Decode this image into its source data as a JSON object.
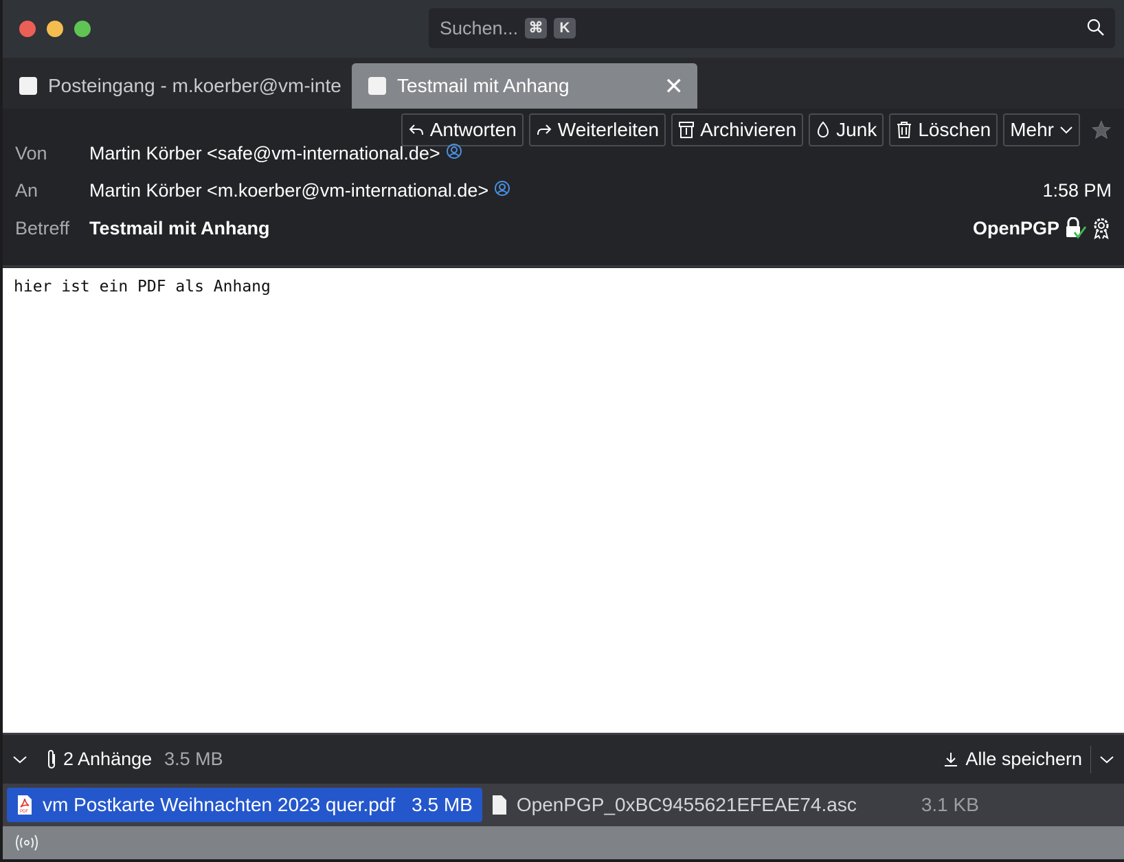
{
  "window": {
    "traffic_lights": {
      "close": "#ec5f57",
      "minimize": "#f5bd4f",
      "zoom": "#5fc454"
    }
  },
  "search": {
    "placeholder": "Suchen...",
    "shortcut_keys": [
      "⌘",
      "K"
    ]
  },
  "tabs": [
    {
      "label": "Posteingang - m.koerber@vm-inte",
      "active": false
    },
    {
      "label": "Testmail mit Anhang",
      "active": true,
      "close": "✕"
    }
  ],
  "toolbar": {
    "reply": "Antworten",
    "forward": "Weiterleiten",
    "archive": "Archivieren",
    "junk": "Junk",
    "delete": "Löschen",
    "more": "Mehr"
  },
  "message": {
    "from_label": "Von",
    "from": "Martin Körber <safe@vm-international.de>",
    "to_label": "An",
    "to": "Martin Körber <m.koerber@vm-international.de>",
    "time": "1:58 PM",
    "subject_label": "Betreff",
    "subject": "Testmail mit Anhang",
    "security": "OpenPGP",
    "body": "hier ist ein PDF als Anhang"
  },
  "attachments": {
    "count_label": "2 Anhänge",
    "total_size": "3.5 MB",
    "save_all": "Alle speichern",
    "items": [
      {
        "name": "vm Postkarte Weihnachten 2023 quer.pdf",
        "size": "3.5 MB",
        "selected": true
      },
      {
        "name": "OpenPGP_0xBC9455621EFEAE74.asc",
        "size": "3.1 KB",
        "selected": false
      }
    ]
  },
  "colors": {
    "accent": "#2457cc",
    "contact_icon": "#4a90e2",
    "check": "#3fb950"
  }
}
